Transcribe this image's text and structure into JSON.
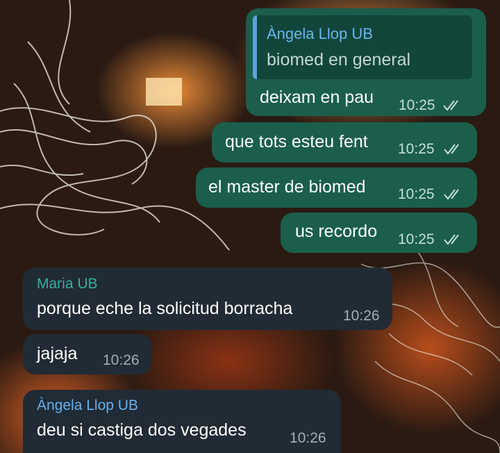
{
  "colors": {
    "outgoing_bubble": "#1b5e4c",
    "incoming_bubble": "#212b35",
    "sender_maria": "#2fb39a",
    "sender_angela": "#64b0ee",
    "reply_accent": "#5aa1e2",
    "read_ticks": "#c7dfd6"
  },
  "messages": [
    {
      "direction": "outgoing",
      "reply": {
        "name": "Àngela Llop UB",
        "text": "biomed en general"
      },
      "text": "deixam en pau",
      "time": "10:25",
      "status_icon": "double-check-icon"
    },
    {
      "direction": "outgoing",
      "text": "que tots esteu fent",
      "time": "10:25",
      "status_icon": "double-check-icon"
    },
    {
      "direction": "outgoing",
      "text": "el master de biomed",
      "time": "10:25",
      "status_icon": "double-check-icon"
    },
    {
      "direction": "outgoing",
      "text": "us recordo",
      "time": "10:25",
      "status_icon": "double-check-icon"
    },
    {
      "direction": "incoming",
      "sender": "Maria UB",
      "text": "porque eche la solicitud borracha",
      "time": "10:26"
    },
    {
      "direction": "incoming",
      "text": "jajaja",
      "time": "10:26"
    },
    {
      "direction": "incoming",
      "sender": "Àngela Llop UB",
      "text": "deu si castiga dos vegades",
      "time": "10:26"
    }
  ]
}
